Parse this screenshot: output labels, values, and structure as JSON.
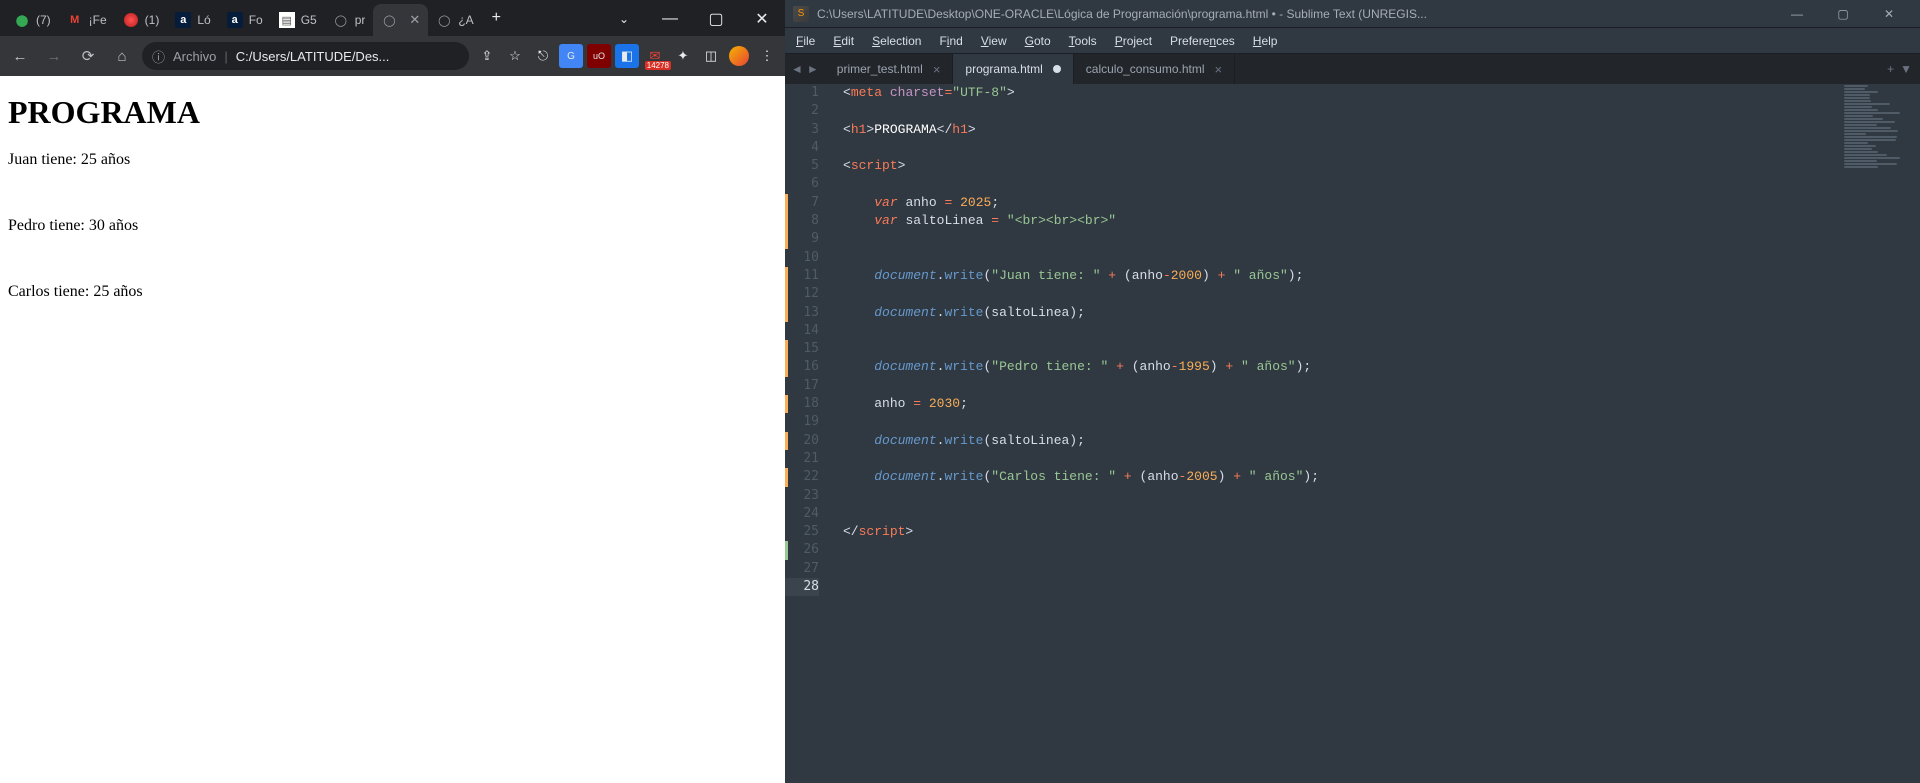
{
  "chrome": {
    "tabs": [
      {
        "favicon": "🟢",
        "text": "(7)"
      },
      {
        "favicon": "M",
        "text": "¡Fe"
      },
      {
        "favicon": "🔴",
        "text": "(1)"
      },
      {
        "favicon": "a",
        "text": "Ló"
      },
      {
        "favicon": "a",
        "text": "Fo"
      },
      {
        "favicon": "📄",
        "text": "G5"
      },
      {
        "favicon": "🌐",
        "text": "pr"
      },
      {
        "favicon": "🌐",
        "text": "",
        "active": true
      },
      {
        "favicon": "🌐",
        "text": "¿A"
      }
    ],
    "address": {
      "scheme_label": "Archivo",
      "path": "C:/Users/LATITUDE/Des..."
    },
    "ext_badge": "14278",
    "page": {
      "title": "PROGRAMA",
      "l1": "Juan tiene: 25 años",
      "l2": "Pedro tiene: 30 años",
      "l3": "Carlos tiene: 25 años"
    }
  },
  "sublime": {
    "title": "C:\\Users\\LATITUDE\\Desktop\\ONE-ORACLE\\Lógica de Programación\\programa.html • - Sublime Text (UNREGIS...",
    "menu": [
      "File",
      "Edit",
      "Selection",
      "Find",
      "View",
      "Goto",
      "Tools",
      "Project",
      "Preferences",
      "Help"
    ],
    "tabs": [
      {
        "name": "primer_test.html",
        "active": false,
        "dirty": false
      },
      {
        "name": "programa.html",
        "active": true,
        "dirty": true
      },
      {
        "name": "calculo_consumo.html",
        "active": false,
        "dirty": false
      }
    ],
    "code": {
      "l1": {
        "tag_open": "<",
        "tag": "meta",
        "attr": "charset",
        "eq": "=",
        "str": "\"UTF-8\"",
        "tag_close": ">"
      },
      "l3": {
        "o": "<",
        "t": "h1",
        "c": ">",
        "txt": "PROGRAMA",
        "co": "</",
        "ct": "h1",
        "cc": ">"
      },
      "l5": {
        "o": "<",
        "t": "script",
        "c": ">"
      },
      "l7": {
        "kw": "var",
        "name": "anho",
        "eq": "=",
        "val": "2025",
        "semi": ";"
      },
      "l8": {
        "kw": "var",
        "name": "saltoLinea",
        "eq": "=",
        "val": "\"<br><br><br>\""
      },
      "l11": {
        "obj": "document",
        "dot": ".",
        "fn": "write",
        "open": "(",
        "s": "\"Juan tiene: \"",
        "p1": " + ",
        "po": "(",
        "v": "anho",
        "m": "-",
        "n": "2000",
        "pc": ")",
        "p2": " + ",
        "s2": "\" años\"",
        "close": ")",
        "semi": ";"
      },
      "l13": {
        "obj": "document",
        "dot": ".",
        "fn": "write",
        "open": "(",
        "arg": "saltoLinea",
        "close": ")",
        "semi": ";"
      },
      "l16": {
        "obj": "document",
        "dot": ".",
        "fn": "write",
        "open": "(",
        "s": "\"Pedro tiene: \"",
        "p1": " + ",
        "po": "(",
        "v": "anho",
        "m": "-",
        "n": "1995",
        "pc": ")",
        "p2": " + ",
        "s2": "\" años\"",
        "close": ")",
        "semi": ";"
      },
      "l18": {
        "v": "anho",
        "eq": " = ",
        "n": "2030",
        "semi": ";"
      },
      "l20": {
        "obj": "document",
        "dot": ".",
        "fn": "write",
        "open": "(",
        "arg": "saltoLinea",
        "close": ")",
        "semi": ";"
      },
      "l22": {
        "obj": "document",
        "dot": ".",
        "fn": "write",
        "open": "(",
        "s": "\"Carlos tiene: \"",
        "p1": " + ",
        "po": "(",
        "v": "anho",
        "m": "-",
        "n": "2005",
        "pc": ")",
        "p2": " + ",
        "s2": "\" años\"",
        "close": ")",
        "semi": ";"
      },
      "l25": {
        "o": "</",
        "t": "script",
        "c": ">"
      }
    },
    "line_numbers": [
      "1",
      "2",
      "3",
      "4",
      "5",
      "6",
      "7",
      "8",
      "9",
      "10",
      "11",
      "12",
      "13",
      "14",
      "15",
      "16",
      "17",
      "18",
      "19",
      "20",
      "21",
      "22",
      "23",
      "24",
      "25",
      "26",
      "27",
      "28"
    ],
    "line_marks": {
      "7": "mod",
      "8": "mod",
      "9": "mod",
      "11": "mod",
      "12": "mod",
      "13": "mod",
      "15": "mod",
      "16": "mod",
      "18": "mod",
      "20": "mod",
      "22": "mod",
      "26": "add",
      "28": "cur"
    }
  }
}
